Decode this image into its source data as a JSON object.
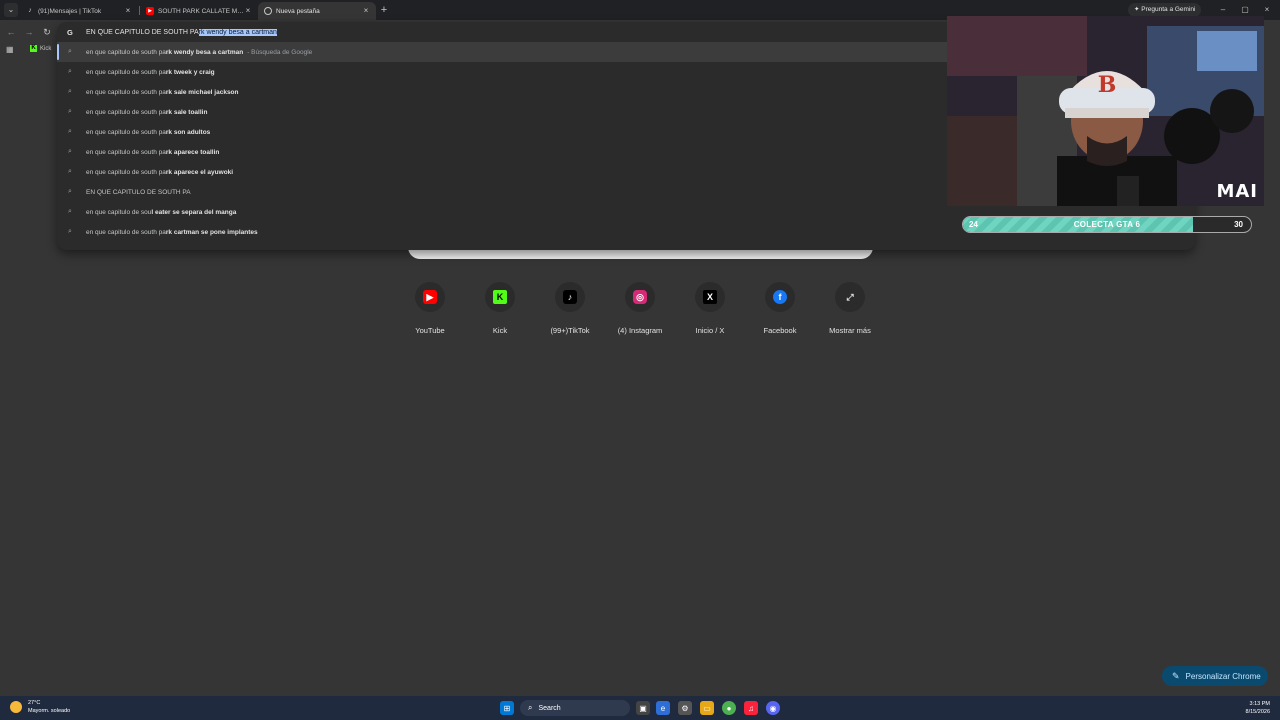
{
  "tabs": [
    {
      "title": "(91)Mensajes | TikTok",
      "icon": "tiktok-icon",
      "active": false
    },
    {
      "title": "SOUTH PARK CALLATE MIERDA",
      "icon": "youtube-icon",
      "active": false
    },
    {
      "title": "Nueva pestaña",
      "icon": "chrome-icon",
      "active": true
    }
  ],
  "gemini_label": "Pregunta a Gemini",
  "bookmarks": {
    "kick_label": "Kick"
  },
  "omnibox": {
    "typed": "EN QUE CAPITULO DE SOUTH PA",
    "completion": "rk wendy besa a cartman",
    "suggestions": [
      {
        "prefix": "en que capitulo de south pa",
        "bold": "rk wendy besa a cartman",
        "sub": "- Búsqueda de Google"
      },
      {
        "prefix": "en que capitulo de south pa",
        "bold": "rk tweek y craig",
        "sub": ""
      },
      {
        "prefix": "en que capitulo de south pa",
        "bold": "rk sale michael jackson",
        "sub": ""
      },
      {
        "prefix": "en que capitulo de south pa",
        "bold": "rk sale toallin",
        "sub": ""
      },
      {
        "prefix": "en que capitulo de south pa",
        "bold": "rk son adultos",
        "sub": ""
      },
      {
        "prefix": "en que capitulo de south pa",
        "bold": "rk aparece toallin",
        "sub": ""
      },
      {
        "prefix": "en que capitulo de south pa",
        "bold": "rk aparece el ayuwoki",
        "sub": ""
      },
      {
        "prefix": "EN QUE CAPITULO DE SOUTH PA",
        "bold": "",
        "sub": ""
      },
      {
        "prefix": "en que capitulo de sou",
        "bold": "l eater se separa del manga",
        "sub": ""
      },
      {
        "prefix": "en que capitulo de south pa",
        "bold": "rk cartman se pone implantes",
        "sub": ""
      }
    ]
  },
  "shortcuts": [
    {
      "label": "YouTube",
      "icon": "youtube-icon",
      "color": "#ff0000"
    },
    {
      "label": "Kick",
      "icon": "kick-icon",
      "color": "#53fc18"
    },
    {
      "label": "(99+)TikTok",
      "icon": "tiktok-icon",
      "color": "#000000"
    },
    {
      "label": "(4) Instagram",
      "icon": "instagram-icon",
      "color": "#d62976"
    },
    {
      "label": "Inicio / X",
      "icon": "x-icon",
      "color": "#000000"
    },
    {
      "label": "Facebook",
      "icon": "facebook-icon",
      "color": "#1877f2"
    },
    {
      "label": "Mostrar más",
      "icon": "expand-icon",
      "color": "#2b2b2b"
    }
  ],
  "stream_overlay": {
    "logo_text": "MAI",
    "goal": {
      "title": "COLECTA GTA 6",
      "current": "24",
      "target": "30",
      "progress": 0.8
    }
  },
  "customize_label": "Personalizar Chrome",
  "taskbar": {
    "weather_temp": "27°C",
    "weather_desc": "Mayorm. soleado",
    "search_label": "Search",
    "time": "3:13 PM",
    "date": "8/15/2026"
  },
  "colors": {
    "accent": "#a8c7fa",
    "background": "#353535",
    "goal_fill": "#6fd4c0"
  }
}
